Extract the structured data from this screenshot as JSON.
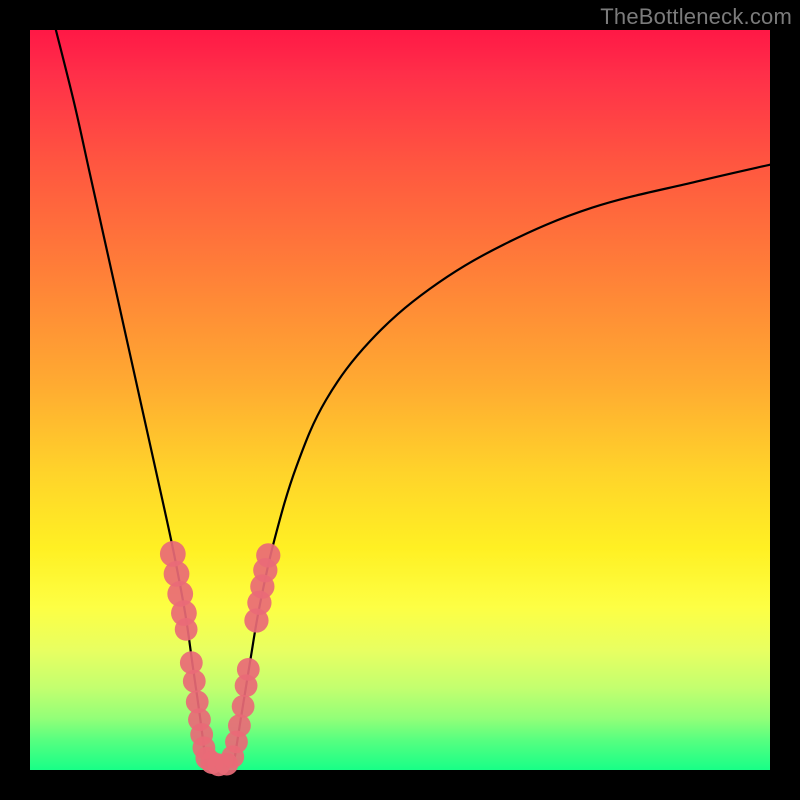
{
  "watermark": "TheBottleneck.com",
  "colors": {
    "gradient_top": "#ff1846",
    "gradient_mid": "#ffd42a",
    "gradient_bottom": "#18ff87",
    "curve": "#000000",
    "marker": "#e96a77",
    "frame": "#000000"
  },
  "chart_data": {
    "type": "line",
    "title": "",
    "xlabel": "",
    "ylabel": "",
    "xlim": [
      0,
      100
    ],
    "ylim": [
      0,
      100
    ],
    "grid": false,
    "series": [
      {
        "name": "left-branch",
        "x": [
          3.5,
          6,
          8,
          10,
          12,
          14,
          16,
          18,
          19.5,
          21,
          22,
          23,
          23.8
        ],
        "values": [
          100,
          90,
          81,
          72,
          63,
          54,
          45,
          36,
          29,
          21,
          14,
          7,
          0.6
        ]
      },
      {
        "name": "right-branch",
        "x": [
          27.5,
          28.5,
          29.8,
          31,
          33,
          36,
          40,
          46,
          54,
          64,
          76,
          90,
          100
        ],
        "values": [
          0.6,
          7,
          15,
          22,
          31,
          41,
          50,
          58,
          65,
          71,
          76,
          79.5,
          81.8
        ]
      }
    ],
    "markers": {
      "name": "highlighted-points",
      "color": "#e96a77",
      "points": [
        {
          "x": 19.3,
          "y": 29.2,
          "r": 1.2
        },
        {
          "x": 19.8,
          "y": 26.5,
          "r": 1.2
        },
        {
          "x": 20.3,
          "y": 23.8,
          "r": 1.2
        },
        {
          "x": 20.8,
          "y": 21.2,
          "r": 1.2
        },
        {
          "x": 21.1,
          "y": 19.0,
          "r": 1.0
        },
        {
          "x": 21.8,
          "y": 14.5,
          "r": 1.0
        },
        {
          "x": 22.2,
          "y": 12.0,
          "r": 1.0
        },
        {
          "x": 22.6,
          "y": 9.2,
          "r": 1.0
        },
        {
          "x": 22.9,
          "y": 6.8,
          "r": 1.0
        },
        {
          "x": 23.2,
          "y": 4.8,
          "r": 1.0
        },
        {
          "x": 23.5,
          "y": 3.0,
          "r": 1.0
        },
        {
          "x": 23.9,
          "y": 1.6,
          "r": 1.0
        },
        {
          "x": 24.6,
          "y": 1.0,
          "r": 1.0
        },
        {
          "x": 25.5,
          "y": 0.7,
          "r": 1.0
        },
        {
          "x": 26.6,
          "y": 0.8,
          "r": 1.0
        },
        {
          "x": 27.4,
          "y": 1.8,
          "r": 1.0
        },
        {
          "x": 27.9,
          "y": 3.8,
          "r": 1.0
        },
        {
          "x": 28.3,
          "y": 6.0,
          "r": 1.0
        },
        {
          "x": 28.8,
          "y": 8.6,
          "r": 1.0
        },
        {
          "x": 29.2,
          "y": 11.4,
          "r": 1.0
        },
        {
          "x": 29.5,
          "y": 13.6,
          "r": 1.0
        },
        {
          "x": 30.6,
          "y": 20.2,
          "r": 1.1
        },
        {
          "x": 31.0,
          "y": 22.6,
          "r": 1.1
        },
        {
          "x": 31.4,
          "y": 24.8,
          "r": 1.1
        },
        {
          "x": 31.8,
          "y": 27.0,
          "r": 1.1
        },
        {
          "x": 32.2,
          "y": 29.0,
          "r": 1.1
        }
      ]
    }
  }
}
